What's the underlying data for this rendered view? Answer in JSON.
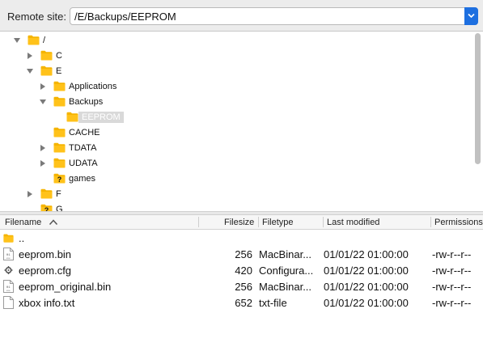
{
  "remote_site": {
    "label": "Remote site:",
    "path": "/E/Backups/EEPROM"
  },
  "tree": {
    "nodes": [
      {
        "label": "/",
        "state": "expanded",
        "icon": "folder-icon"
      },
      {
        "label": "C",
        "state": "collapsed",
        "icon": "folder-icon"
      },
      {
        "label": "E",
        "state": "expanded",
        "icon": "folder-icon"
      },
      {
        "label": "Applications",
        "state": "collapsed",
        "icon": "folder-icon"
      },
      {
        "label": "Backups",
        "state": "expanded",
        "icon": "folder-icon"
      },
      {
        "label": "EEPROM",
        "state": "selected",
        "icon": "folder-icon"
      },
      {
        "label": "CACHE",
        "state": "leaf",
        "icon": "folder-icon"
      },
      {
        "label": "TDATA",
        "state": "collapsed",
        "icon": "folder-icon"
      },
      {
        "label": "UDATA",
        "state": "collapsed",
        "icon": "folder-icon"
      },
      {
        "label": "games",
        "state": "leaf",
        "icon": "unknown-folder-icon"
      },
      {
        "label": "F",
        "state": "collapsed",
        "icon": "folder-icon"
      },
      {
        "label": "G",
        "state": "leaf",
        "icon": "unknown-folder-icon"
      }
    ]
  },
  "filelist": {
    "columns": {
      "filename": "Filename",
      "filesize": "Filesize",
      "filetype": "Filetype",
      "modified": "Last modified",
      "permissions": "Permissions"
    },
    "sort_indicator": "sort-ascending-icon",
    "rows": [
      {
        "name": "..",
        "size": "",
        "type": "",
        "modified": "",
        "perms": "",
        "icon": "folder-icon"
      },
      {
        "name": "eeprom.bin",
        "size": "256",
        "type": "MacBinar...",
        "modified": "01/01/22 01:00:00",
        "perms": "-rw-r--r--",
        "icon": "binary-file-icon"
      },
      {
        "name": "eeprom.cfg",
        "size": "420",
        "type": "Configura...",
        "modified": "01/01/22 01:00:00",
        "perms": "-rw-r--r--",
        "icon": "config-file-icon"
      },
      {
        "name": "eeprom_original.bin",
        "size": "256",
        "type": "MacBinar...",
        "modified": "01/01/22 01:00:00",
        "perms": "-rw-r--r--",
        "icon": "binary-file-icon"
      },
      {
        "name": "xbox info.txt",
        "size": "652",
        "type": "txt-file",
        "modified": "01/01/22 01:00:00",
        "perms": "-rw-r--r--",
        "icon": "text-file-icon"
      }
    ]
  },
  "colors": {
    "accent": "#1d6fe0",
    "folder": "#f5b400",
    "selection": "#d9d9d9"
  }
}
